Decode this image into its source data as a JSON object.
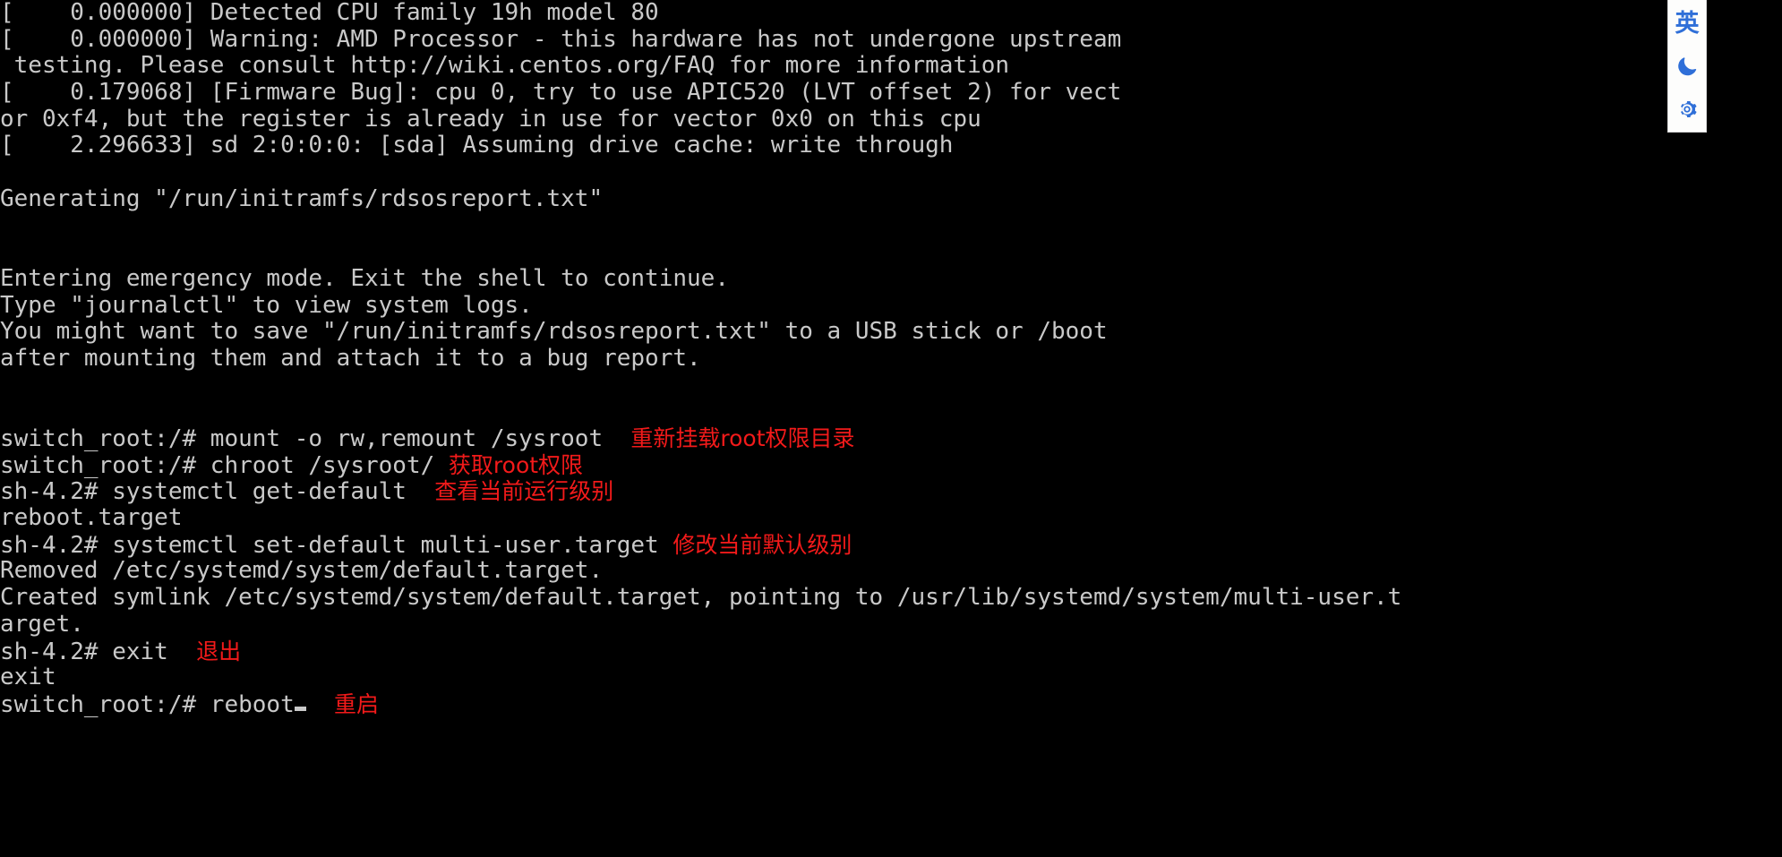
{
  "screen": {
    "type": "linux-console",
    "background_color": "#000000",
    "text_color": "#c9c9c9",
    "annotation_color": "#f21a1a"
  },
  "console": {
    "lines": [
      {
        "id": "kmsg-cpu-family",
        "text": "[    0.000000] Detected CPU family 19h model 80",
        "kind": "kernel"
      },
      {
        "id": "kmsg-amd-warning",
        "text": "[    0.000000] Warning: AMD Processor - this hardware has not undergone upstream",
        "kind": "kernel"
      },
      {
        "id": "kmsg-amd-warning-cont",
        "text": " testing. Please consult http://wiki.centos.org/FAQ for more information",
        "kind": "kernel"
      },
      {
        "id": "kmsg-firmware-bug",
        "text": "[    0.179068] [Firmware Bug]: cpu 0, try to use APIC520 (LVT offset 2) for vect",
        "kind": "kernel"
      },
      {
        "id": "kmsg-firmware-bug-cont",
        "text": "or 0xf4, but the register is already in use for vector 0x0 on this cpu",
        "kind": "kernel"
      },
      {
        "id": "kmsg-sda-cache",
        "text": "[    2.296633] sd 2:0:0:0: [sda] Assuming drive cache: write through",
        "kind": "kernel"
      },
      {
        "id": "blank-1",
        "text": "",
        "kind": "blank"
      },
      {
        "id": "generating-report",
        "text": "Generating \"/run/initramfs/rdsosreport.txt\"",
        "kind": "output"
      },
      {
        "id": "blank-2",
        "text": "",
        "kind": "blank"
      },
      {
        "id": "blank-3",
        "text": "",
        "kind": "blank"
      },
      {
        "id": "emergency-mode",
        "text": "Entering emergency mode. Exit the shell to continue.",
        "kind": "output"
      },
      {
        "id": "journalctl-hint",
        "text": "Type \"journalctl\" to view system logs.",
        "kind": "output"
      },
      {
        "id": "save-report-hint",
        "text": "You might want to save \"/run/initramfs/rdsosreport.txt\" to a USB stick or /boot",
        "kind": "output"
      },
      {
        "id": "save-report-hint-cont",
        "text": "after mounting them and attach it to a bug report.",
        "kind": "output"
      },
      {
        "id": "blank-4",
        "text": "",
        "kind": "blank"
      },
      {
        "id": "blank-5",
        "text": "",
        "kind": "blank"
      },
      {
        "id": "cmd-mount-remount",
        "text": "switch_root:/# mount -o rw,remount /sysroot",
        "kind": "command",
        "annotation": "重新挂载root权限目录",
        "annotation_gap": 2
      },
      {
        "id": "cmd-chroot",
        "text": "switch_root:/# chroot /sysroot/",
        "kind": "command",
        "annotation": "获取root权限",
        "annotation_gap": 1
      },
      {
        "id": "cmd-get-default",
        "text": "sh-4.2# systemctl get-default",
        "kind": "command",
        "annotation": "查看当前运行级别",
        "annotation_gap": 2
      },
      {
        "id": "out-reboot-target",
        "text": "reboot.target",
        "kind": "output"
      },
      {
        "id": "cmd-set-default",
        "text": "sh-4.2# systemctl set-default multi-user.target",
        "kind": "command",
        "annotation": "修改当前默认级别",
        "annotation_gap": 1
      },
      {
        "id": "out-removed-target",
        "text": "Removed /etc/systemd/system/default.target.",
        "kind": "output"
      },
      {
        "id": "out-created-symlink",
        "text": "Created symlink /etc/systemd/system/default.target, pointing to /usr/lib/systemd/system/multi-user.t",
        "kind": "output"
      },
      {
        "id": "out-created-symlink-wrap",
        "text": "arget.",
        "kind": "output"
      },
      {
        "id": "cmd-exit",
        "text": "sh-4.2# exit",
        "kind": "command",
        "annotation": "退出",
        "annotation_gap": 2
      },
      {
        "id": "out-exit",
        "text": "exit",
        "kind": "output"
      },
      {
        "id": "cmd-reboot",
        "text": "switch_root:/# reboot",
        "kind": "command",
        "annotation": "重启",
        "annotation_gap": 2,
        "cursor": true
      }
    ]
  },
  "ime_toolbar": {
    "visible": true,
    "accent_color": "#2f6fd8",
    "background_color": "#fdfdfc",
    "buttons": [
      {
        "id": "lang-mode",
        "name": "language-mode-button",
        "icon": "language-english-icon",
        "label": "英",
        "type": "text"
      },
      {
        "id": "dark-mode",
        "name": "dark-mode-button",
        "icon": "moon-icon",
        "label": "",
        "type": "svg"
      },
      {
        "id": "settings",
        "name": "settings-button",
        "icon": "gear-icon",
        "label": "",
        "type": "svg"
      }
    ]
  }
}
